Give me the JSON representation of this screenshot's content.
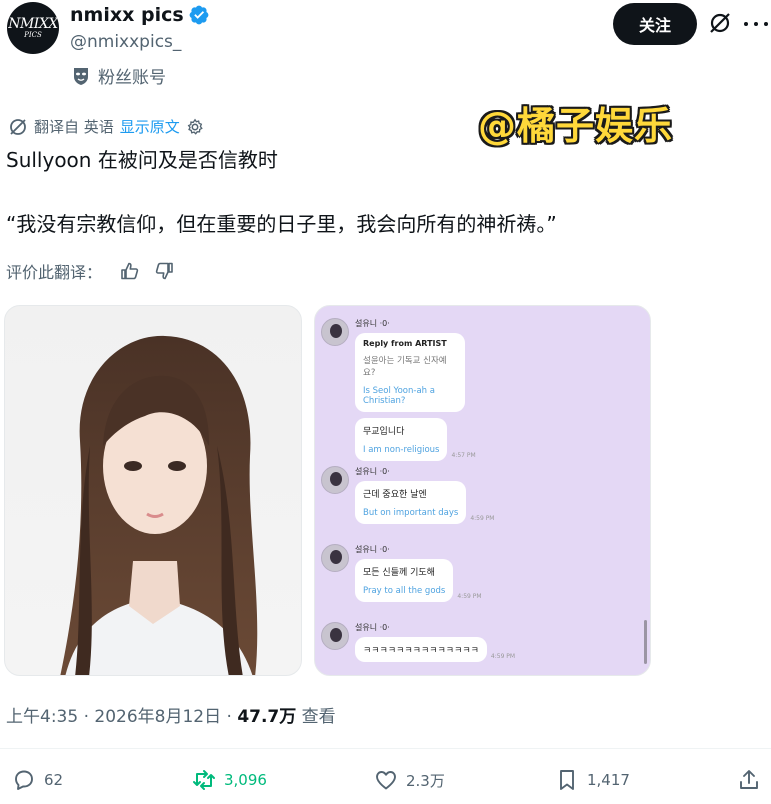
{
  "header": {
    "avatar_logo_line1": "NMIXX",
    "avatar_logo_line2": "PICS",
    "display_name": "nmixx pics",
    "handle": "@nmixxpics_",
    "fan_label": "粉丝账号",
    "follow_label": "关注"
  },
  "translation": {
    "prefix": "翻译自 英语",
    "show_original": "显示原文"
  },
  "watermark": "@橘子娱乐",
  "tweet": {
    "line1": "Sullyoon 在被问及是否信教时",
    "line2": "“我没有宗教信仰，但在重要的日子里，我会向所有的神祈祷。”"
  },
  "rating": {
    "label": "评价此翻译："
  },
  "chat": {
    "sender": "설유니 ·0·",
    "messages": [
      {
        "header": "Reply from ARTIST",
        "question": "설윤아는 기독교 신자예요?",
        "question_en": "Is Seol Yoon-ah a Christian?"
      },
      {
        "ko": "무교입니다",
        "en": "I am non-religious",
        "time": "4:57 PM"
      },
      {
        "ko": "근데 중요한 날엔",
        "en": "But on important days",
        "time": "4:59 PM"
      },
      {
        "ko": "모든 신들께 기도해",
        "en": "Pray to all the gods",
        "time": "4:59 PM"
      },
      {
        "ko": "ㅋㅋㅋㅋㅋㅋㅋㅋㅋㅋㅋㅋㅋㅋ",
        "time": "4:59 PM"
      }
    ]
  },
  "meta": {
    "time_date": "上午4:35 · 2026年8月12日 · ",
    "views_num": "47.7万",
    "views_label": " 查看"
  },
  "actions": {
    "replies": "62",
    "retweets": "3,096",
    "likes": "2.3万",
    "bookmarks": "1,417"
  },
  "colors": {
    "accent": "#1d9bf0",
    "retweet": "#00ba7c",
    "muted": "#536471",
    "chat_bg": "#e4d8f5",
    "watermark": "#ffd83a"
  },
  "icons": [
    "verified-icon",
    "mask-icon",
    "grok-icon",
    "more-icon",
    "translate-icon",
    "settings-icon",
    "thumbs-up-icon",
    "thumbs-down-icon",
    "reply-icon",
    "retweet-icon",
    "like-icon",
    "bookmark-icon",
    "share-icon"
  ]
}
